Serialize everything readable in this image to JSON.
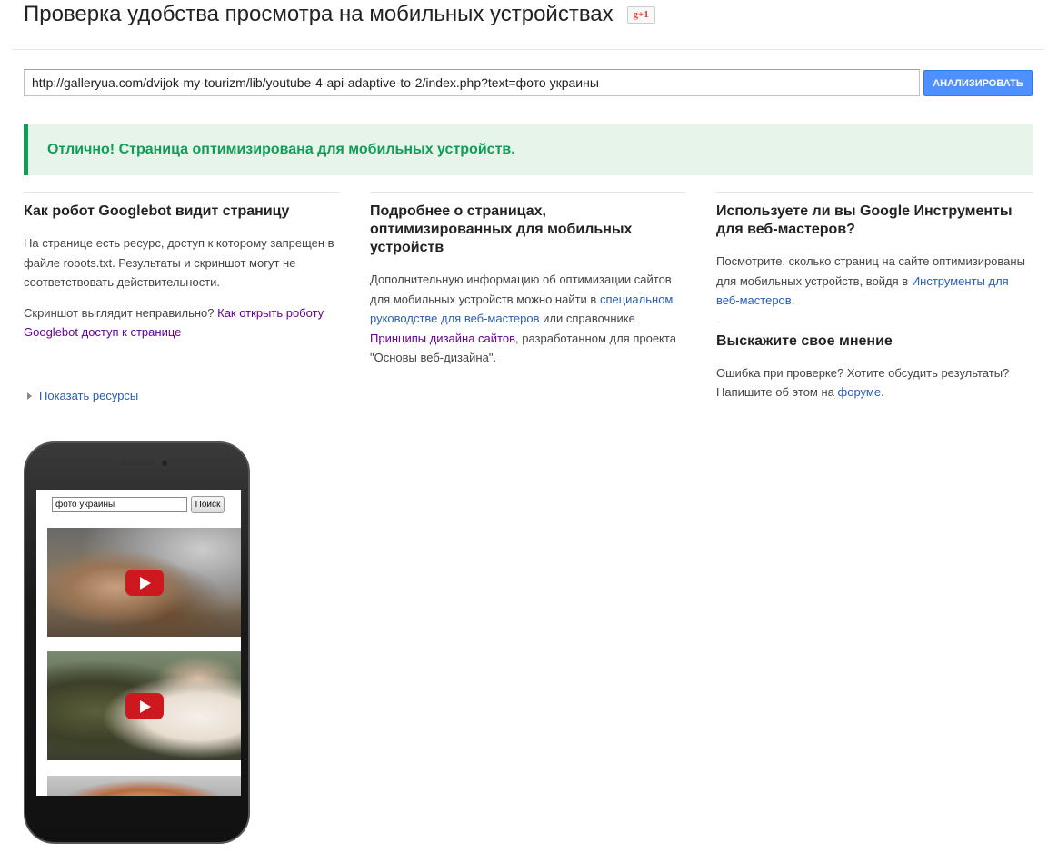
{
  "header": {
    "title": "Проверка удобства просмотра на мобильных устройствах",
    "gplus_label": "g+1"
  },
  "form": {
    "url_value": "http://galleryua.com/dvijok-my-tourizm/lib/youtube-4-api-adaptive-to-2/index.php?text=фото украины",
    "analyze_label": "АНАЛИЗИРОВАТЬ"
  },
  "result": {
    "message": "Отлично! Страница оптимизирована для мобильных устройств."
  },
  "col1": {
    "heading": "Как робот Googlebot видит страницу",
    "para1": "На странице есть ресурс, доступ к которому запрещен в файле robots.txt. Результаты и скриншот могут не соответствовать действительности.",
    "para2_prefix": "Скриншот выглядит неправильно? ",
    "para2_link": "Как открыть роботу Googlebot доступ к странице",
    "show_resources": "Показать ресурсы"
  },
  "col2": {
    "heading": "Подробнее о страницах, оптимизированных для мобильных устройств",
    "text1": "Дополнительную информацию об оптимизации сайтов для мобильных устройств можно найти в ",
    "link1": "специальном руководстве для веб-мастеров",
    "text2": " или справочнике ",
    "link2": "Принципы дизайна сайтов",
    "text3": ", разработанном для проекта \"Основы веб-дизайна\"."
  },
  "col3": {
    "heading1": "Используете ли вы Google Инструменты для веб-мастеров?",
    "text1": "Посмотрите, сколько страниц на сайте оптимизированы для мобильных устройств, войдя в ",
    "link1": "Инструменты для веб-мастеров",
    "text1_end": ".",
    "heading2": "Выскажите свое мнение",
    "text2": "Ошибка при проверке? Хотите обсудить результаты? Напишите об этом на ",
    "link2": "форуме",
    "text2_end": "."
  },
  "phone_preview": {
    "search_value": "фото украины",
    "search_button": "Поиск"
  },
  "colors": {
    "accent_blue": "#4d90fe",
    "success_green": "#0f9d58",
    "success_bg": "#e6f4ea",
    "link": "#2a5db0",
    "visited_link": "#660099",
    "youtube_red": "#cc181e"
  }
}
